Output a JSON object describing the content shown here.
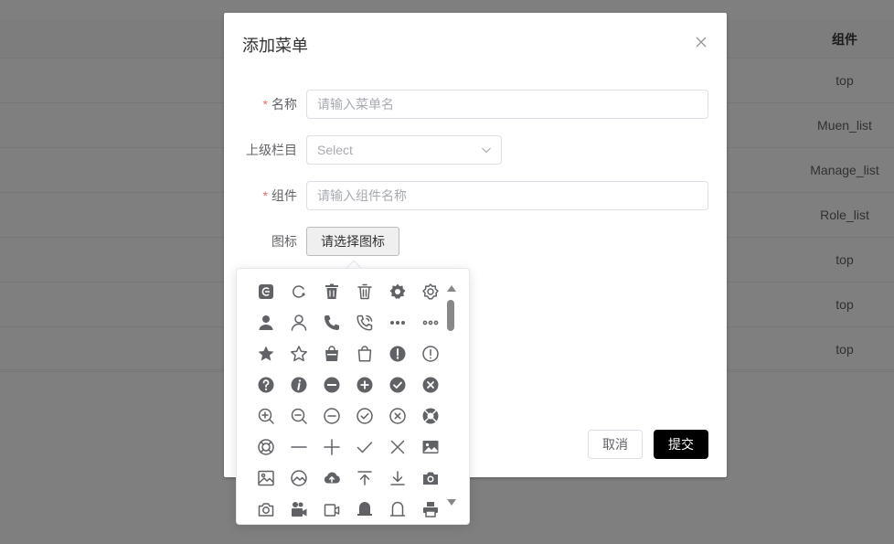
{
  "background_table": {
    "header": "组件",
    "rows": [
      "top",
      "Muen_list",
      "Manage_list",
      "Role_list",
      "top",
      "top",
      "top"
    ]
  },
  "dialog": {
    "title": "添加菜单",
    "fields": {
      "name": {
        "label": "名称",
        "placeholder": "请输入菜单名",
        "required_mark": "*"
      },
      "parent": {
        "label": "上级栏目",
        "placeholder": "Select"
      },
      "component": {
        "label": "组件",
        "placeholder": "请输入组件名称",
        "required_mark": "*"
      },
      "icon": {
        "label": "图标",
        "button_label": "请选择图标"
      }
    },
    "buttons": {
      "cancel": "取消",
      "submit": "提交"
    }
  },
  "icon_picker": {
    "icons": [
      "edit-filled-icon",
      "refresh-arrow-icon",
      "delete-filled-icon",
      "delete-icon",
      "settings-filled-icon",
      "settings-icon",
      "user-filled-icon",
      "user-icon",
      "phone-filled-icon",
      "phone-icon",
      "more-filled-icon",
      "more-icon",
      "star-filled-icon",
      "star-icon",
      "shopping-bag-filled-icon",
      "shopping-bag-icon",
      "warning-filled-icon",
      "warning-icon",
      "question-filled-icon",
      "info-filled-icon",
      "remove-filled-icon",
      "circle-plus-filled-icon",
      "success-filled-icon",
      "circle-close-filled-icon",
      "zoom-in-icon",
      "zoom-out-icon",
      "remove-icon",
      "circle-check-icon",
      "circle-close-icon",
      "help-filled-icon",
      "help-icon",
      "minus-icon",
      "plus-icon",
      "check-icon",
      "close-icon",
      "picture-filled-icon",
      "picture-icon",
      "picture-rounded-icon",
      "upload-filled-icon",
      "upload-icon",
      "download-icon",
      "camera-filled-icon",
      "camera-icon",
      "video-camera-filled-icon",
      "video-camera-icon",
      "bell-filled-icon",
      "bell-icon",
      "printer-icon"
    ]
  },
  "colors": {
    "overlay": "rgba(0,0,0,0.5)",
    "required": "#f56c6c",
    "icon": "#606266",
    "submit_bg": "#000000"
  }
}
